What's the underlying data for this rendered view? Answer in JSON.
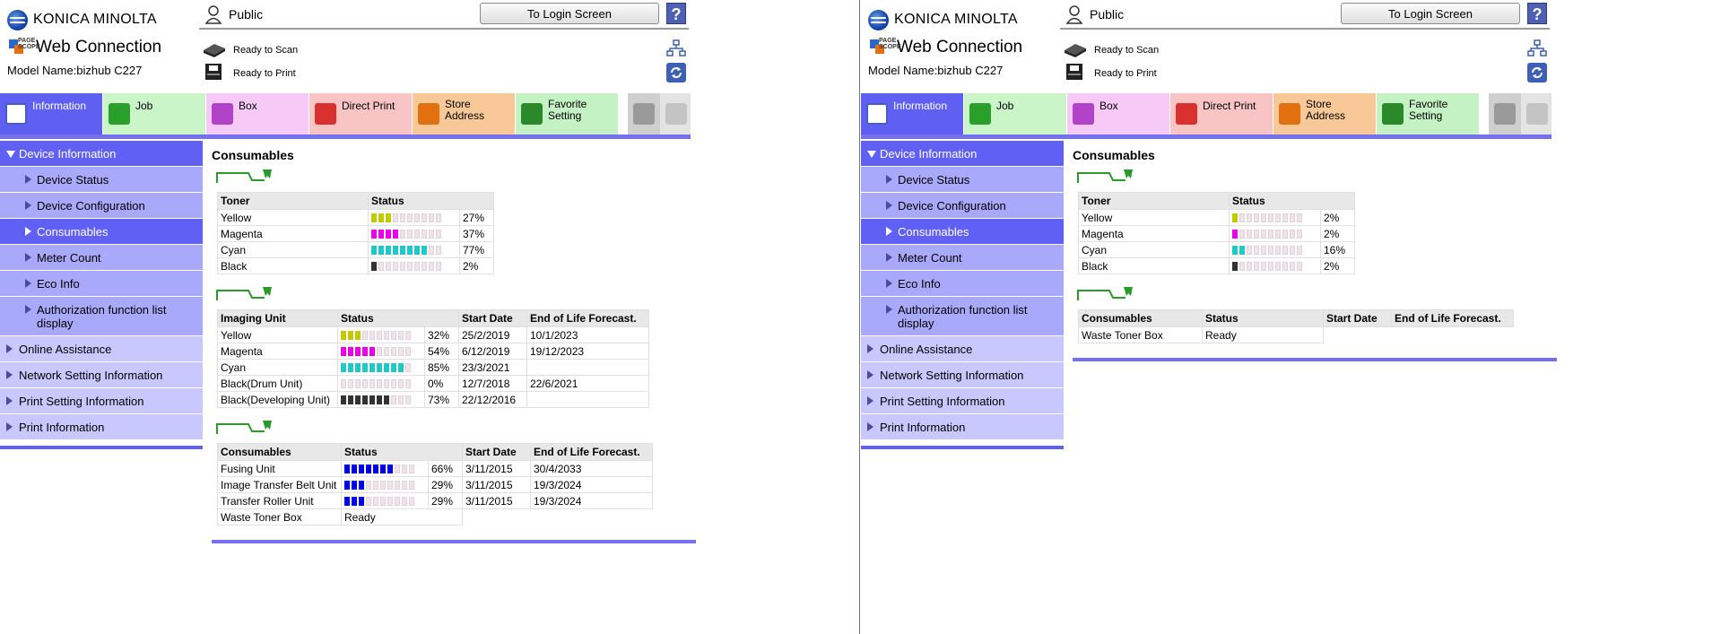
{
  "header": {
    "brand": "KONICA MINOLTA",
    "product": "Web Connection",
    "logo_small_text": "PAGE SCOPE",
    "model": "Model Name:bizhub C227",
    "user": "Public",
    "login_button": "To Login Screen",
    "help": "?",
    "status_scan": "Ready to Scan",
    "status_print": "Ready to Print"
  },
  "tabs": [
    {
      "label": "Information",
      "bg": "#5f5ff2",
      "color": "#ffffff"
    },
    {
      "label": "Job",
      "bg": "#c9f5c9"
    },
    {
      "label": "Box",
      "bg": "#f7c9f7"
    },
    {
      "label": "Direct Print",
      "bg": "#f8c4c4"
    },
    {
      "label": "Store Address",
      "bg": "#f8c898"
    },
    {
      "label": "Favorite Setting",
      "bg": "#c5f2c5"
    }
  ],
  "sidebar": [
    "Device Information",
    "Device Status",
    "Device Configuration",
    "Consumables",
    "Meter Count",
    "Eco Info",
    "Authorization function list display",
    "Online Assistance",
    "Network Setting Information",
    "Print Setting Information",
    "Print Information"
  ],
  "colors": {
    "yellow": "#c8c800",
    "magenta": "#e800e8",
    "cyan": "#20c8c8",
    "black": "#333333",
    "blue": "#0000e0",
    "accent": "#6060f4"
  },
  "left": {
    "title": "Consumables",
    "toner": {
      "headers": [
        "Toner",
        "Status"
      ],
      "rows": [
        {
          "name": "Yellow",
          "color": "yellow",
          "level": 27,
          "pct": "27%"
        },
        {
          "name": "Magenta",
          "color": "magenta",
          "level": 37,
          "pct": "37%"
        },
        {
          "name": "Cyan",
          "color": "cyan",
          "level": 77,
          "pct": "77%"
        },
        {
          "name": "Black",
          "color": "black",
          "level": 2,
          "pct": "2%"
        }
      ]
    },
    "imaging": {
      "headers": [
        "Imaging Unit",
        "Status",
        "Start Date",
        "End of Life Forecast."
      ],
      "rows": [
        {
          "name": "Yellow",
          "color": "yellow",
          "level": 32,
          "pct": "32%",
          "start": "25/2/2019",
          "end": "10/1/2023"
        },
        {
          "name": "Magenta",
          "color": "magenta",
          "level": 54,
          "pct": "54%",
          "start": "6/12/2019",
          "end": "19/12/2023"
        },
        {
          "name": "Cyan",
          "color": "cyan",
          "level": 85,
          "pct": "85%",
          "start": "23/3/2021",
          "end": ""
        },
        {
          "name": "Black(Drum Unit)",
          "color": "black",
          "level": 0,
          "pct": "0%",
          "start": "12/7/2018",
          "end": "22/6/2021"
        },
        {
          "name": "Black(Developing Unit)",
          "color": "black",
          "level": 73,
          "pct": "73%",
          "start": "22/12/2016",
          "end": ""
        }
      ]
    },
    "consumables": {
      "headers": [
        "Consumables",
        "Status",
        "Start Date",
        "End of Life Forecast."
      ],
      "rows": [
        {
          "name": "Fusing Unit",
          "color": "blue",
          "level": 66,
          "pct": "66%",
          "start": "3/11/2015",
          "end": "30/4/2033"
        },
        {
          "name": "Image Transfer Belt Unit",
          "color": "blue",
          "level": 29,
          "pct": "29%",
          "start": "3/11/2015",
          "end": "19/3/2024"
        },
        {
          "name": "Transfer Roller Unit",
          "color": "blue",
          "level": 29,
          "pct": "29%",
          "start": "3/11/2015",
          "end": "19/3/2024"
        }
      ],
      "waste": {
        "name": "Waste Toner Box",
        "status": "Ready"
      }
    }
  },
  "right": {
    "title": "Consumables",
    "toner": {
      "headers": [
        "Toner",
        "Status"
      ],
      "rows": [
        {
          "name": "Yellow",
          "color": "yellow",
          "level": 2,
          "pct": "2%"
        },
        {
          "name": "Magenta",
          "color": "magenta",
          "level": 2,
          "pct": "2%"
        },
        {
          "name": "Cyan",
          "color": "cyan",
          "level": 16,
          "pct": "16%"
        },
        {
          "name": "Black",
          "color": "black",
          "level": 2,
          "pct": "2%"
        }
      ]
    },
    "consumables": {
      "headers": [
        "Consumables",
        "Status",
        "Start Date",
        "End of Life Forecast."
      ],
      "waste": {
        "name": "Waste Toner Box",
        "status": "Ready"
      }
    }
  }
}
